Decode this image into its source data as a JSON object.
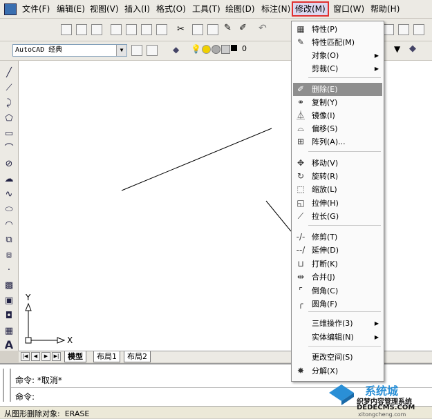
{
  "menubar": {
    "items": [
      {
        "label": "文件(F)",
        "active": false
      },
      {
        "label": "编辑(E)",
        "active": false
      },
      {
        "label": "视图(V)",
        "active": false
      },
      {
        "label": "插入(I)",
        "active": false
      },
      {
        "label": "格式(O)",
        "active": false
      },
      {
        "label": "工具(T)",
        "active": false
      },
      {
        "label": "绘图(D)",
        "active": false
      },
      {
        "label": "标注(N)",
        "active": false
      },
      {
        "label": "修改(M)",
        "active": true
      },
      {
        "label": "窗口(W)",
        "active": false
      },
      {
        "label": "帮助(H)",
        "active": false
      }
    ]
  },
  "toolbar": {
    "workspace_combo": "AutoCAD 经典",
    "layer_combo": "0"
  },
  "ucs": {
    "x_label": "X",
    "y_label": "Y"
  },
  "layout_tabs": [
    "模型",
    "布局1",
    "布局2"
  ],
  "command": {
    "line1": "命令: *取消*",
    "line2": "命令:"
  },
  "status": {
    "text": "从图形删除对象:  ERASE"
  },
  "dropdown": {
    "items": [
      {
        "label": "特性(P)",
        "icon": "properties-icon",
        "glyph": "▦",
        "submenu": false,
        "highlight": false
      },
      {
        "label": "特性匹配(M)",
        "icon": "match-properties-icon",
        "glyph": "✎",
        "submenu": false,
        "highlight": false
      },
      {
        "label": "对象(O)",
        "icon": "",
        "glyph": "",
        "submenu": true,
        "highlight": false
      },
      {
        "label": "剪裁(C)",
        "icon": "",
        "glyph": "",
        "submenu": true,
        "highlight": false
      },
      {
        "label": "删除(E)",
        "icon": "erase-icon",
        "glyph": "✐",
        "submenu": false,
        "highlight": true
      },
      {
        "label": "复制(Y)",
        "icon": "copy-icon",
        "glyph": "⚭",
        "submenu": false,
        "highlight": false
      },
      {
        "label": "镜像(I)",
        "icon": "mirror-icon",
        "glyph": "⏅",
        "submenu": false,
        "highlight": false
      },
      {
        "label": "偏移(S)",
        "icon": "offset-icon",
        "glyph": "⌓",
        "submenu": false,
        "highlight": false
      },
      {
        "label": "阵列(A)...",
        "icon": "array-icon",
        "glyph": "⊞",
        "submenu": false,
        "highlight": false
      },
      {
        "label": "移动(V)",
        "icon": "move-icon",
        "glyph": "✥",
        "submenu": false,
        "highlight": false
      },
      {
        "label": "旋转(R)",
        "icon": "rotate-icon",
        "glyph": "↻",
        "submenu": false,
        "highlight": false
      },
      {
        "label": "缩放(L)",
        "icon": "scale-icon",
        "glyph": "⬚",
        "submenu": false,
        "highlight": false
      },
      {
        "label": "拉伸(H)",
        "icon": "stretch-icon",
        "glyph": "◱",
        "submenu": false,
        "highlight": false
      },
      {
        "label": "拉长(G)",
        "icon": "lengthen-icon",
        "glyph": "⟋",
        "submenu": false,
        "highlight": false
      },
      {
        "label": "修剪(T)",
        "icon": "trim-icon",
        "glyph": "-/-",
        "submenu": false,
        "highlight": false
      },
      {
        "label": "延伸(D)",
        "icon": "extend-icon",
        "glyph": "--/",
        "submenu": false,
        "highlight": false
      },
      {
        "label": "打断(K)",
        "icon": "break-icon",
        "glyph": "⊔",
        "submenu": false,
        "highlight": false
      },
      {
        "label": "合并(J)",
        "icon": "join-icon",
        "glyph": "⇹",
        "submenu": false,
        "highlight": false
      },
      {
        "label": "倒角(C)",
        "icon": "chamfer-icon",
        "glyph": "⌜",
        "submenu": false,
        "highlight": false
      },
      {
        "label": "圆角(F)",
        "icon": "fillet-icon",
        "glyph": "╭",
        "submenu": false,
        "highlight": false
      },
      {
        "label": "三维操作(3)",
        "icon": "",
        "glyph": "",
        "submenu": true,
        "highlight": false
      },
      {
        "label": "实体编辑(N)",
        "icon": "",
        "glyph": "",
        "submenu": true,
        "highlight": false
      },
      {
        "label": "更改空间(S)",
        "icon": "",
        "glyph": "",
        "submenu": false,
        "highlight": false
      },
      {
        "label": "分解(X)",
        "icon": "explode-icon",
        "glyph": "✸",
        "submenu": false,
        "highlight": false
      }
    ]
  },
  "watermark": {
    "brand": "系统城",
    "line1": "织梦内容管理系统",
    "line2": "DEDECMS.COM",
    "line3": "xitongcheng.com"
  },
  "colors": {
    "menu_highlight": "#8e8e8e",
    "annotation_red": "#e03030",
    "canvas": "#ffffff"
  }
}
